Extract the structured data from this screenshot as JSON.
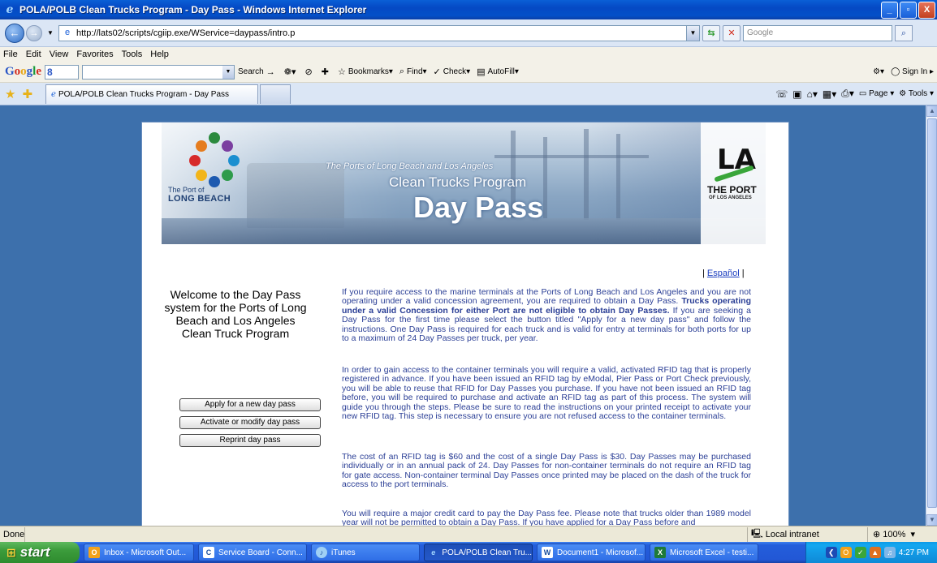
{
  "window": {
    "title": "POLA/POLB Clean Trucks Program - Day Pass - Windows Internet Explorer",
    "minimize": "_",
    "maximize": "▫",
    "close": "X"
  },
  "address_bar": {
    "url": "http://lats02/scripts/cgiip.exe/WService=daypass/intro.p",
    "search_placeholder": "Google"
  },
  "menu": [
    "File",
    "Edit",
    "View",
    "Favorites",
    "Tools",
    "Help"
  ],
  "google_toolbar": {
    "g_value": "8",
    "search": "Search",
    "bookmarks": "Bookmarks",
    "find": "Find",
    "check": "Check",
    "autofill": "AutoFill",
    "sign_in": "Sign In"
  },
  "tabs": {
    "active_label": "POLA/POLB Clean Trucks Program - Day Pass",
    "page_menu": "Page",
    "tools_menu": "Tools"
  },
  "banner": {
    "lb_the_port_of": "The Port of",
    "lb_name": "LONG BEACH",
    "subtitle": "The Ports of Long Beach and Los Angeles",
    "program": "Clean Trucks Program",
    "day_pass": "Day Pass",
    "la_mark": "LA",
    "la_line1": "THE PORT",
    "la_line2": "OF LOS ANGELES"
  },
  "page": {
    "espanol_prefix": "| ",
    "espanol": "Español",
    "espanol_suffix": " |",
    "welcome": "Welcome to the Day Pass system for the Ports of Long Beach and Los Angeles Clean Truck Program",
    "buttons": {
      "apply": "Apply for a new day pass",
      "activate": "Activate or modify day pass",
      "reprint": "Reprint day pass"
    },
    "p1_a": "If you require access to the marine terminals at the Ports of Long Beach and Los Angeles and you are not operating under a valid concession agreement, you are required to obtain a Day Pass. ",
    "p1_bold": "Trucks operating under a valid Concession for either Port are not eligible to obtain Day Passes.",
    "p1_b": " If you are seeking a Day Pass for the first time please select the button titled \"Apply for a new day pass\" and follow the instructions. One Day Pass is required for each truck and is valid for entry at terminals for both ports for up to a maximum of 24 Day Passes per truck, per year.",
    "p2": "In order to gain access to the container terminals you will require a valid, activated RFID tag that is properly registered in advance. If you have been issued an RFID tag by eModal, Pier Pass or Port Check previously, you will be able to reuse that RFID for Day Passes you purchase. If you have not been issued an RFID tag before, you will be required to purchase and activate an RFID tag as part of this process. The system will guide you through the steps. Please be sure to read the instructions on your printed receipt to activate your new RFID tag. This step is necessary to ensure you are not refused access to the container terminals.",
    "p3": "The cost of an RFID tag is $60 and the cost of a single Day Pass is $30. Day Passes may be purchased individually or in an annual pack of 24. Day Passes for non-container terminals do not require an RFID tag for gate access. Non-container terminal Day Passes once printed may be placed on the dash of the truck for access to the port terminals.",
    "p4": "You will require a major credit card to pay the Day Pass fee. Please note that trucks older than 1989 model year will not be permitted to obtain a Day Pass. If you have applied for a Day Pass before and"
  },
  "status_bar": {
    "status": "Done",
    "zone": "Local intranet",
    "zoom": "100%"
  },
  "taskbar": {
    "start": "start",
    "items": [
      "Inbox - Microsoft Out...",
      "Service Board - Conn...",
      "iTunes",
      "POLA/POLB Clean Tru...",
      "Document1 - Microsof...",
      "Microsoft Excel - testi..."
    ],
    "clock": "4:27 PM"
  }
}
